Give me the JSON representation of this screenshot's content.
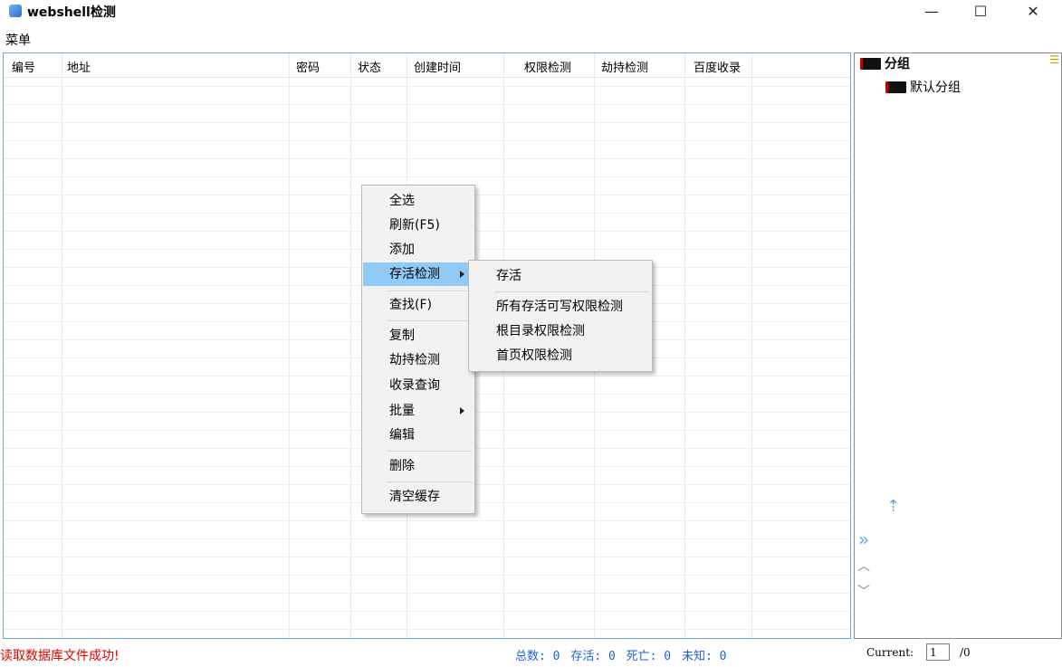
{
  "window": {
    "title": "webshell检测",
    "minimize": "—",
    "maximize": "☐",
    "close": "✕"
  },
  "menubar": {
    "menu": "菜单"
  },
  "table": {
    "columns": [
      "编号",
      "地址",
      "密码",
      "状态",
      "创建时间",
      "权限检测",
      "劫持检测",
      "百度收录"
    ]
  },
  "context_menu": {
    "items": [
      "全选",
      "刷新(F5)",
      "添加",
      "存活检测",
      "查找(F)",
      "复制",
      "劫持检测",
      "收录查询",
      "批量",
      "编辑",
      "删除",
      "清空缓存"
    ],
    "highlighted": "存活检测"
  },
  "submenu": {
    "items": [
      "存活",
      "所有存活可写权限检测",
      "根目录权限检测",
      "首页权限检测"
    ]
  },
  "tree": {
    "root": "分组",
    "child": "默认分组"
  },
  "status": {
    "message": "读取数据库文件成功!",
    "total": "总数: 0",
    "alive": "存活: 0",
    "dead": "死亡: 0",
    "unknown": "未知: 0",
    "current_label": "Current:",
    "current_page": "1",
    "total_pages": "/0"
  },
  "colors": {
    "accent": "#91c9f7",
    "error": "#e00000",
    "stats": "#1f5fd6"
  },
  "icons": [
    "app-icon",
    "folder-icon",
    "upload-icon",
    "double-chevron-right-icon",
    "chevron-up-icon",
    "chevron-down-icon",
    "list-icon"
  ]
}
